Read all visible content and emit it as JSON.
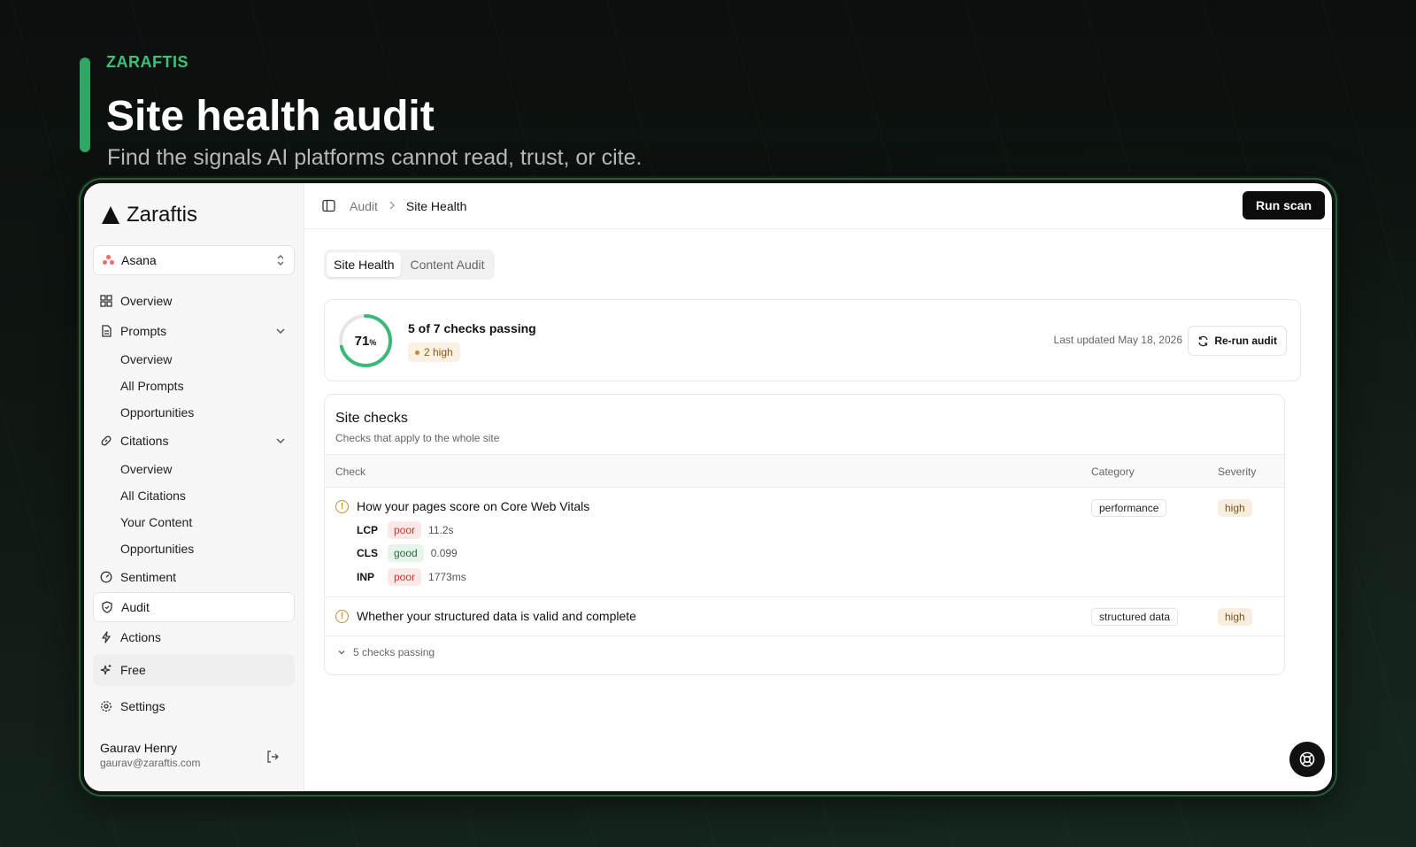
{
  "hero": {
    "brand": "ZARAFTIS",
    "title": "Site health audit",
    "subtitle": "Find the signals AI platforms cannot read, trust, or cite."
  },
  "app": {
    "logo_text": "Zaraftis",
    "project": {
      "name": "Asana"
    },
    "nav": {
      "overview": "Overview",
      "prompts": "Prompts",
      "prompts_sub": [
        "Overview",
        "All Prompts",
        "Opportunities"
      ],
      "citations": "Citations",
      "citations_sub": [
        "Overview",
        "All Citations",
        "Your Content",
        "Opportunities"
      ],
      "sentiment": "Sentiment",
      "audit": "Audit",
      "actions": "Actions",
      "free": "Free",
      "settings": "Settings"
    },
    "user": {
      "name": "Gaurav Henry",
      "email": "gaurav@zaraftis.com"
    },
    "breadcrumb": [
      "Audit",
      "Site Health"
    ],
    "run_scan_label": "Run scan",
    "tabs": [
      "Site Health",
      "Content Audit"
    ],
    "summary": {
      "score_value": "71",
      "score_unit": "%",
      "score_fraction": 0.71,
      "checks_text": "5 of 7 checks passing",
      "high_badge": "2 high",
      "last_updated": "Last updated May 18, 2026",
      "rerun_label": "Re-run audit"
    },
    "site_checks": {
      "title": "Site checks",
      "subtitle": "Checks that apply to the whole site",
      "columns": [
        "Check",
        "Category",
        "Severity"
      ],
      "rows": [
        {
          "title": "How your pages score on Core Web Vitals",
          "category": "performance",
          "severity": "high",
          "metrics": [
            {
              "name": "LCP",
              "status": "poor",
              "value": "11.2s"
            },
            {
              "name": "CLS",
              "status": "good",
              "value": "0.099"
            },
            {
              "name": "INP",
              "status": "poor",
              "value": "1773ms"
            }
          ]
        },
        {
          "title": "Whether your structured data is valid and complete",
          "category": "structured data",
          "severity": "high"
        }
      ],
      "passing_label": "5 checks passing"
    },
    "colors": {
      "accent_green": "#2fa866",
      "gauge_green": "#3cb878",
      "warning": "#d08a2c",
      "poor": "#c0392b",
      "good": "#2d6a40"
    }
  }
}
